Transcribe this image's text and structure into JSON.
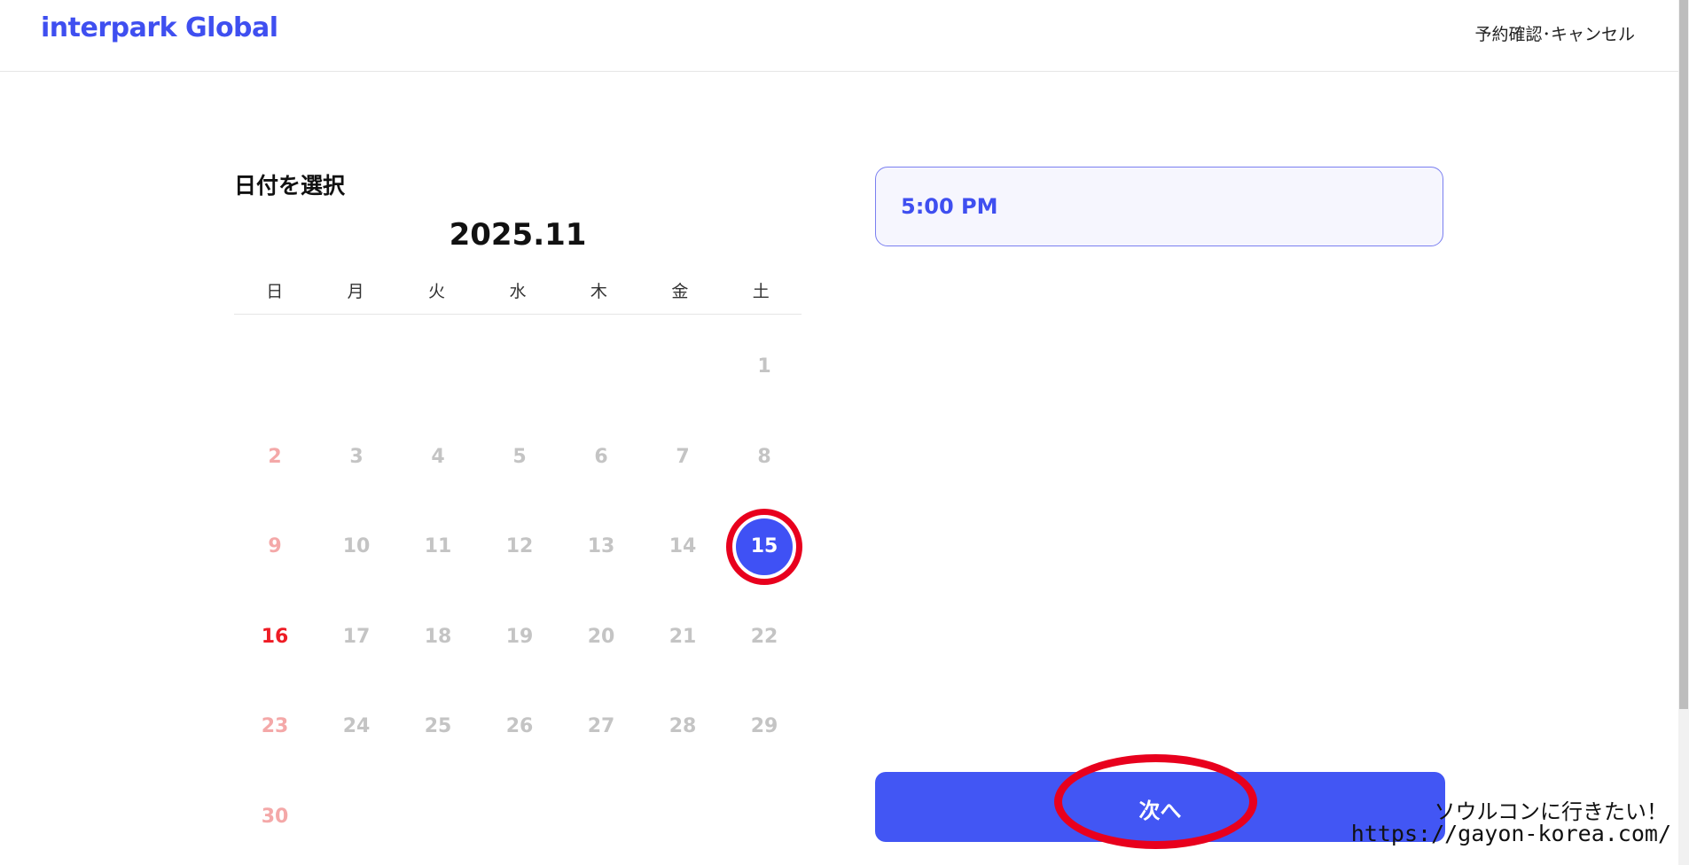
{
  "header": {
    "logo": "interpark Global",
    "link": "予約確認･キャンセル"
  },
  "calendar": {
    "title": "日付を選択",
    "month": "2025.11",
    "weekdays": [
      "日",
      "月",
      "火",
      "水",
      "木",
      "金",
      "土"
    ],
    "weeks": [
      [
        "",
        "",
        "",
        "",
        "",
        "",
        "1"
      ],
      [
        "2",
        "3",
        "4",
        "5",
        "6",
        "7",
        "8"
      ],
      [
        "9",
        "10",
        "11",
        "12",
        "13",
        "14",
        "15"
      ],
      [
        "16",
        "17",
        "18",
        "19",
        "20",
        "21",
        "22"
      ],
      [
        "23",
        "24",
        "25",
        "26",
        "27",
        "28",
        "29"
      ],
      [
        "30",
        "",
        "",
        "",
        "",
        "",
        ""
      ]
    ],
    "selected": "15",
    "active_sunday": "16",
    "colors": {
      "selected_bg": "#3f51f5",
      "disabled": "#c4c4c4",
      "sunday_disabled": "#f4a8a8",
      "sunday_active": "#ee1c25"
    }
  },
  "time": {
    "selected": "5:00 PM"
  },
  "actions": {
    "next_label": "次へ",
    "button_color": "#4256f4"
  },
  "annotations": {
    "ring_color": "#e8001d"
  },
  "watermark": {
    "line1": "ソウルコンに行きたい！",
    "line2": "https://gayon-korea.com/"
  }
}
